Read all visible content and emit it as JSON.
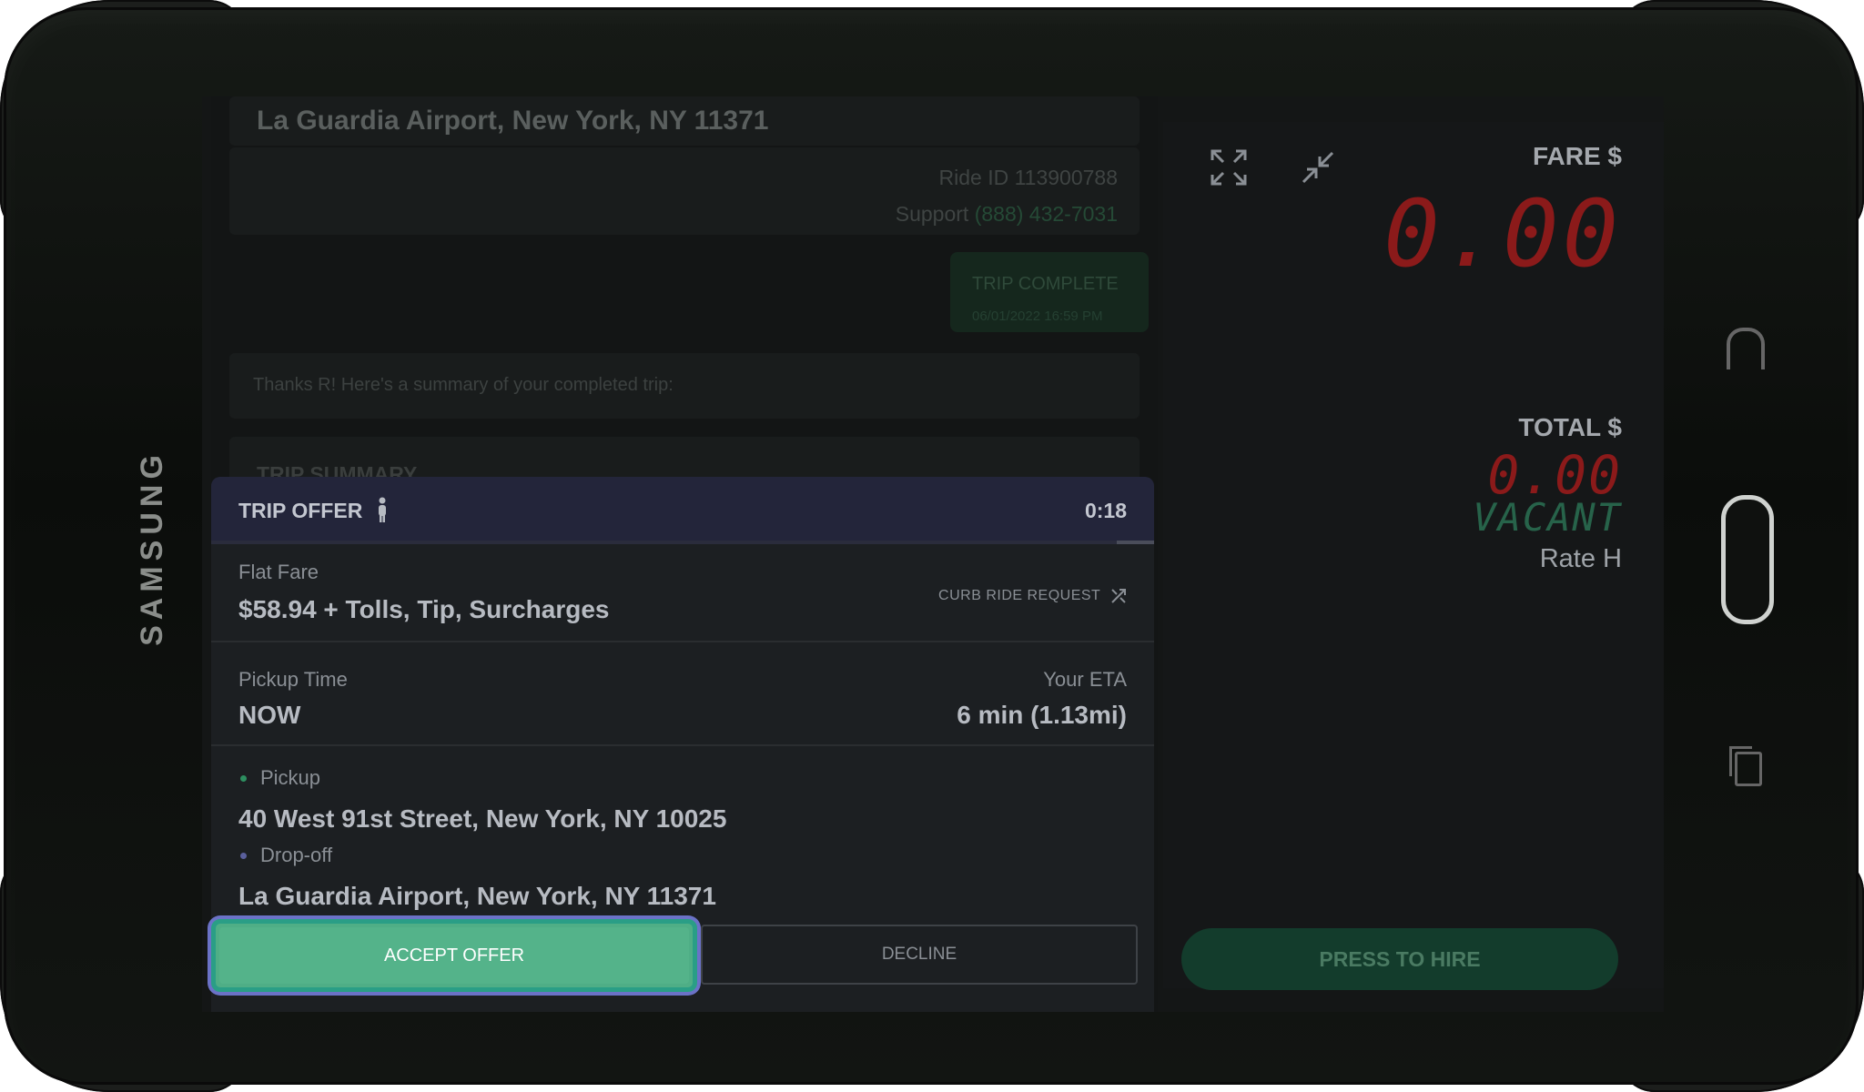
{
  "device": {
    "brand": "SAMSUNG"
  },
  "background_chat": {
    "dropoff_address": "La Guardia Airport, New York, NY 11371",
    "ride_id": "Ride ID 113900788",
    "support_label": "Support",
    "support_phone": "(888) 432-7031",
    "status_title": "TRIP COMPLETE",
    "status_date": "06/01/2022 16:59 PM",
    "thanks_message": "Thanks R! Here's a summary of your completed trip:",
    "summary_title": "TRIP SUMMARY"
  },
  "offer": {
    "title": "TRIP OFFER",
    "timer": "0:18",
    "timer_progress": 0.04,
    "fare_label": "Flat Fare",
    "fare_value": "$58.94 + Tolls, Tip, Surcharges",
    "request_type": "CURB RIDE REQUEST",
    "pickup_time_label": "Pickup Time",
    "pickup_time_value": "NOW",
    "eta_label": "Your ETA",
    "eta_value": "6 min (1.13mi)",
    "pickup_label": "Pickup",
    "pickup_address": "40 West 91st Street, New York, NY 10025",
    "dropoff_label": "Drop-off",
    "dropoff_address": "La Guardia Airport, New York, NY 11371",
    "accept_label": "ACCEPT OFFER",
    "decline_label": "DECLINE"
  },
  "meter": {
    "fare_label": "FARE $",
    "fare_value": "0.00",
    "total_label": "TOTAL $",
    "total_value": "0.00",
    "status": "VACANT",
    "rate": "Rate H",
    "hire_label": "PRESS TO HIRE"
  },
  "colors": {
    "accent_green": "#54b38a",
    "focus_ring": "#6b72c7",
    "meter_red": "#8b1a1a",
    "vacant_green": "#27634a"
  },
  "icons": [
    "person-icon",
    "expand-icon",
    "collapse-icon",
    "curb-request-icon",
    "back-button-icon",
    "home-button-icon",
    "recent-apps-icon"
  ]
}
